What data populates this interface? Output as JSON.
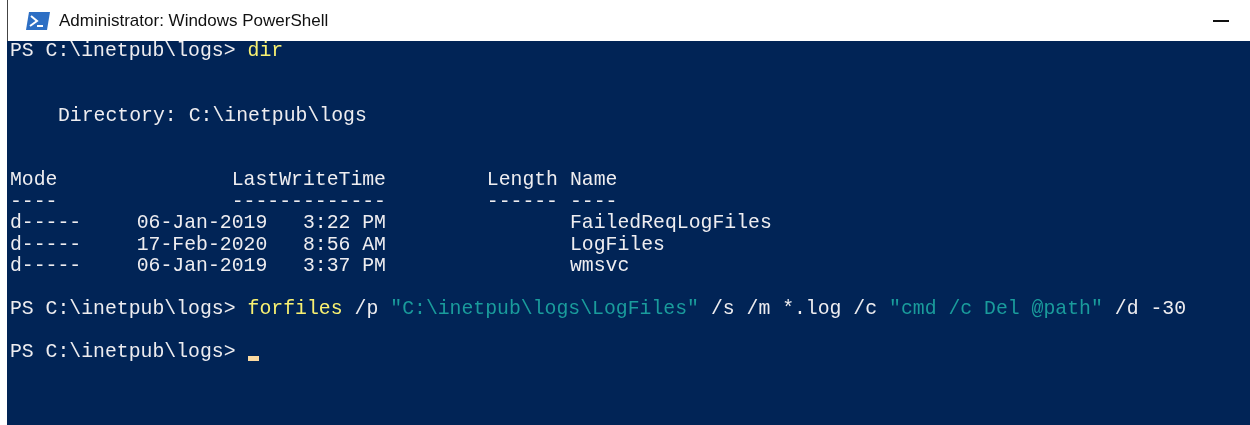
{
  "window": {
    "title": "Administrator: Windows PowerShell"
  },
  "session": [
    {
      "kind": "command",
      "prompt": "PS C:\\inetpub\\logs>",
      "segments": [
        {
          "kind": "command",
          "text": "dir"
        }
      ]
    },
    {
      "kind": "directory_header",
      "label": "Directory:",
      "path": "C:\\inetpub\\logs"
    },
    {
      "kind": "table",
      "columns": [
        {
          "label": "Mode",
          "underline": "----"
        },
        {
          "label": "LastWriteTime",
          "underline": "-------------"
        },
        {
          "label": "Length",
          "underline": "------"
        },
        {
          "label": "Name",
          "underline": "----"
        }
      ],
      "rows": [
        [
          "d-----",
          "06-Jan-2019   3:22 PM",
          "",
          "FailedReqLogFiles"
        ],
        [
          "d-----",
          "17-Feb-2020   8:56 AM",
          "",
          "LogFiles"
        ],
        [
          "d-----",
          "06-Jan-2019   3:37 PM",
          "",
          "wmsvc"
        ]
      ]
    },
    {
      "kind": "command",
      "prompt": "PS C:\\inetpub\\logs>",
      "segments": [
        {
          "kind": "command",
          "text": "forfiles"
        },
        {
          "kind": "parameter",
          "text": "/p"
        },
        {
          "kind": "string",
          "text": "\"C:\\inetpub\\logs\\LogFiles\""
        },
        {
          "kind": "parameter",
          "text": "/s /m *.log /c"
        },
        {
          "kind": "string",
          "text": "\"cmd /c Del @path\""
        },
        {
          "kind": "parameter",
          "text": "/d -30"
        }
      ]
    },
    {
      "kind": "prompt",
      "prompt": "PS C:\\inetpub\\logs>",
      "cursor": true
    }
  ]
}
